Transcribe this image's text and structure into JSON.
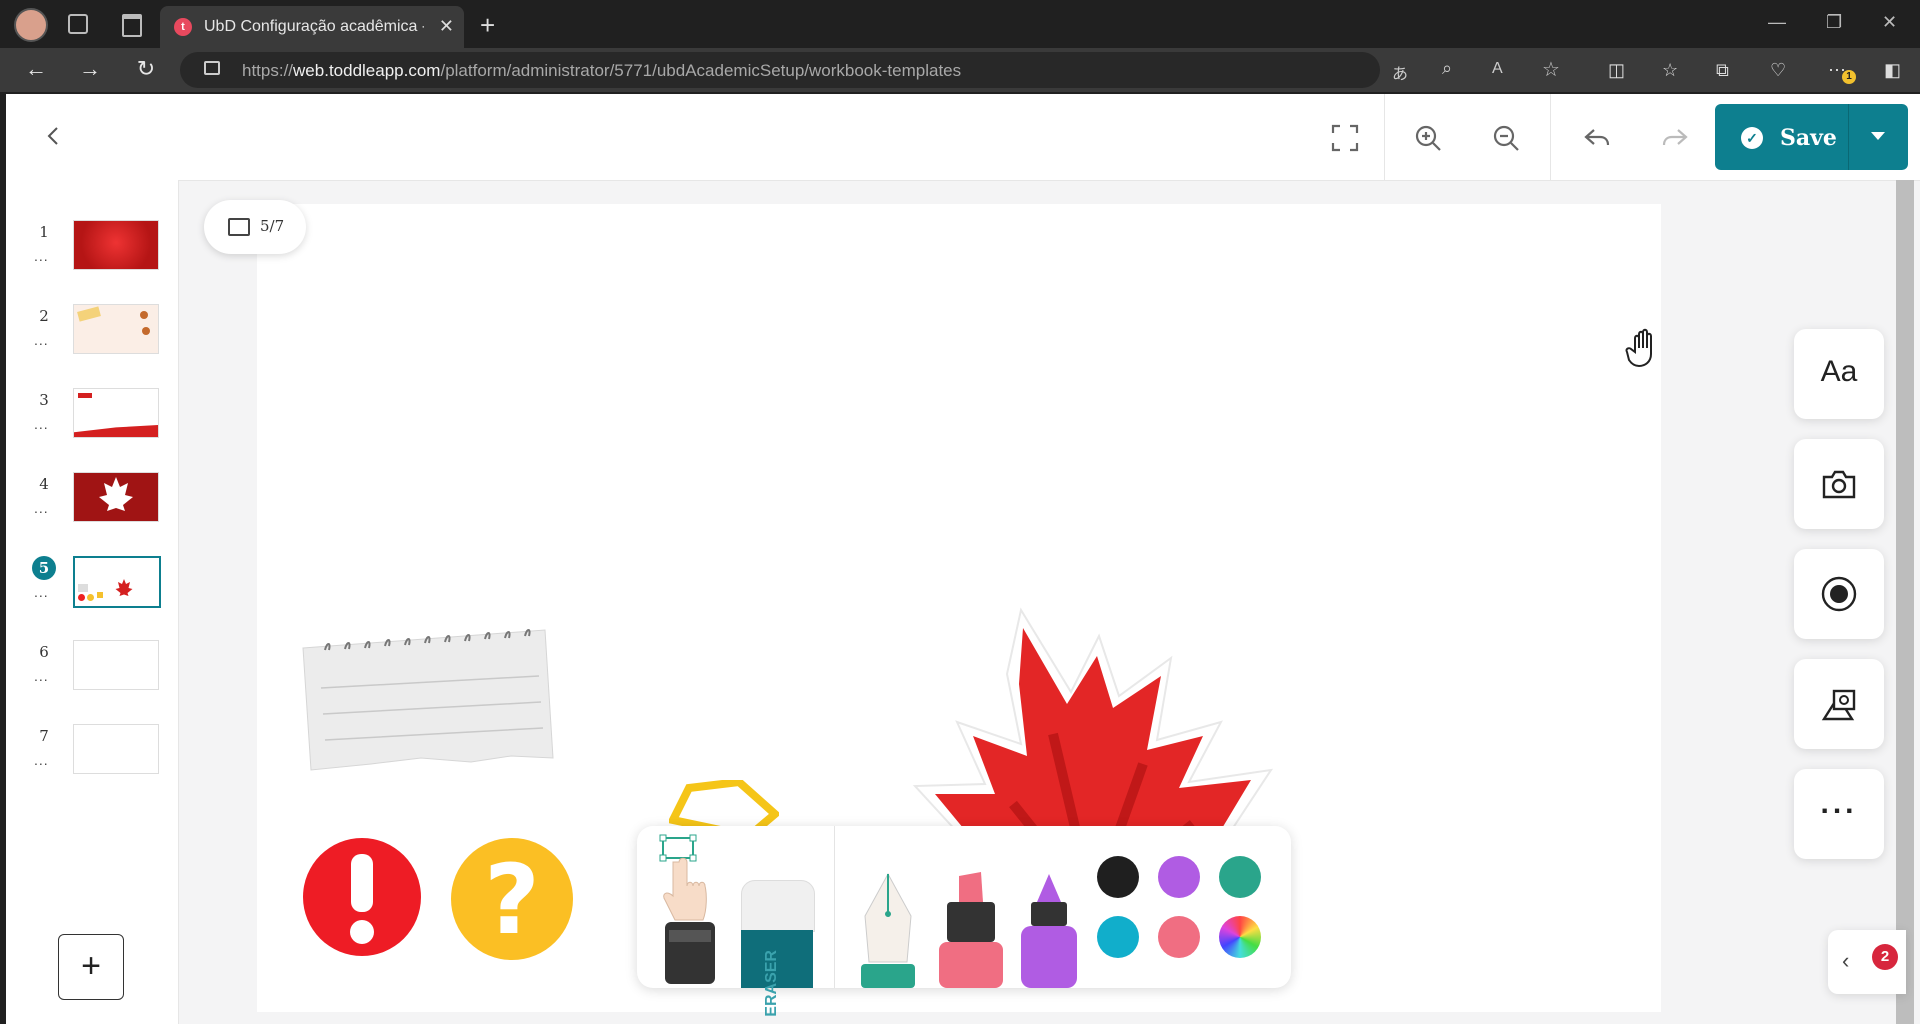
{
  "browser": {
    "tab_title": "UbD Configuração acadêmica - M",
    "favicon_letter": "t",
    "url_prefix": "https://",
    "url_domain": "web.toddleapp.com",
    "url_path": "/platform/administrator/5771/ubdAcademicSetup/workbook-templates",
    "notification_count": "1"
  },
  "toolbar": {
    "save_label": "Save"
  },
  "counter": {
    "label": "5/7"
  },
  "slides": [
    {
      "number": "1",
      "dots": "..."
    },
    {
      "number": "2",
      "dots": "..."
    },
    {
      "number": "3",
      "dots": "..."
    },
    {
      "number": "4",
      "dots": "..."
    },
    {
      "number": "5",
      "dots": "..."
    },
    {
      "number": "6",
      "dots": "..."
    },
    {
      "number": "7",
      "dots": "..."
    }
  ],
  "active_slide": "5",
  "add_slide_symbol": "+",
  "right_tools": {
    "text_label": "Aa",
    "more_label": "..."
  },
  "panel_badge": "2",
  "eraser_text": "ERASER",
  "colors": {
    "accent": "#0d7f8f",
    "swatches": [
      "#1f1f1f",
      "#b05ce3",
      "#2aa58b",
      "#11aecb",
      "#f06e82"
    ]
  }
}
